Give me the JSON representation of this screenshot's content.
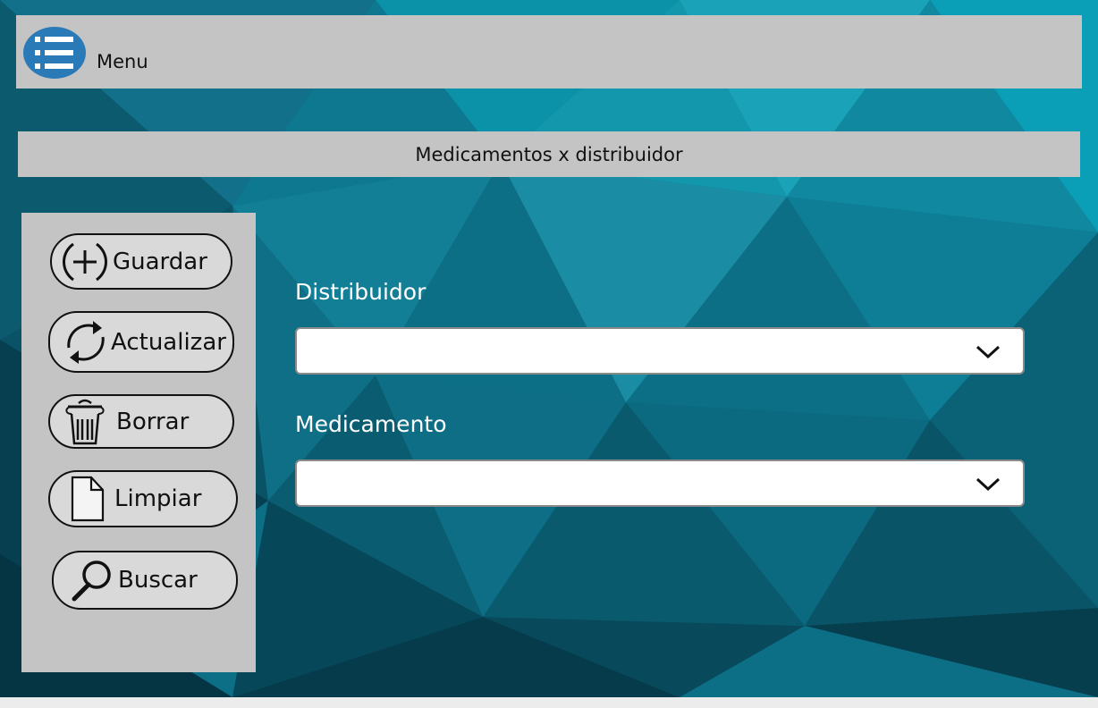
{
  "header": {
    "menu_label": "Menu",
    "menu_icon": "list-icon"
  },
  "page": {
    "title": "Medicamentos x distribuidor"
  },
  "actions": {
    "save": {
      "label": "Guardar",
      "icon": "plus-circle-icon"
    },
    "update": {
      "label": "Actualizar",
      "icon": "refresh-icon"
    },
    "delete": {
      "label": "Borrar",
      "icon": "trash-icon"
    },
    "clear": {
      "label": "Limpiar",
      "icon": "document-icon"
    },
    "search": {
      "label": "Buscar",
      "icon": "search-icon"
    }
  },
  "form": {
    "distributor": {
      "label": "Distribuidor",
      "value": ""
    },
    "medication": {
      "label": "Medicamento",
      "value": ""
    }
  },
  "colors": {
    "background": "#0c6f86",
    "panel": "#c4c4c4",
    "menu_icon": "#2a7ab8"
  }
}
